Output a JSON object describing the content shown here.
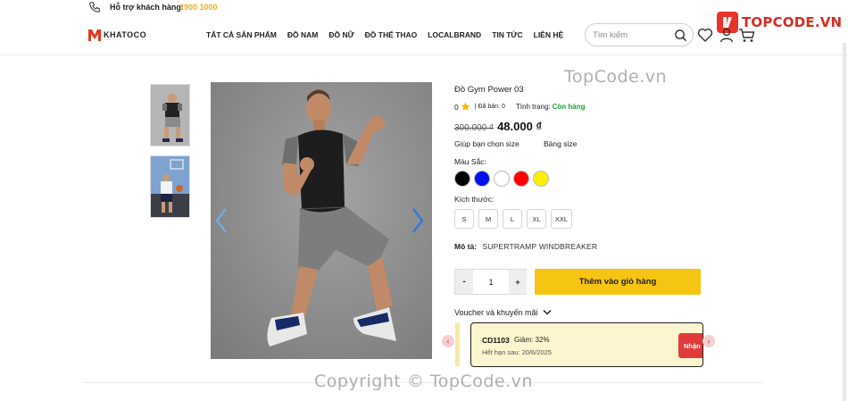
{
  "topbar": {
    "support_label": "Hỗ trợ khách hàng:",
    "support_phone": "1900 1000",
    "phone_icon": "phone-icon"
  },
  "watermark_logo": {
    "text": "TOPCODE.VN"
  },
  "header": {
    "brand_name": "KHATOCO",
    "nav": [
      "TẤT CẢ SẢN PHẨM",
      "ĐỒ NAM",
      "ĐỒ NỮ",
      "ĐỒ THỂ THAO",
      "LOCALBRAND",
      "TIN TỨC",
      "LIÊN HỆ"
    ],
    "search_placeholder": "Tìm kiếm",
    "icons": [
      "search-icon",
      "heart-icon",
      "user-icon",
      "cart-icon"
    ]
  },
  "product": {
    "title": "Đồ Gym Power 03",
    "rating": "0",
    "sold_label": "| Đã bán:",
    "sold_count": "0",
    "status_label": "Tình trạng:",
    "status_value": "Còn hàng",
    "old_price": "300.000 ₫",
    "new_price": "48.000 ₫",
    "size_help": "Giúp bạn chọn size",
    "size_chart": "Bảng size",
    "color_label": "Màu Sắc:",
    "colors": [
      "#000000",
      "#0011ee",
      "#ffffff",
      "#ff0000",
      "#ffee00"
    ],
    "size_label": "Kích thước:",
    "sizes": [
      "S",
      "M",
      "L",
      "XL",
      "XXL"
    ],
    "desc_label": "Mô tả:",
    "desc_value": "SUPERTRAMP WINDBREAKER",
    "quantity": "1",
    "minus": "-",
    "plus": "+",
    "add_to_cart": "Thêm vào giỏ hàng",
    "voucher_title": "Voucher và khuyến mãi"
  },
  "voucher": {
    "code": "CD1103",
    "discount": "Giảm: 32%",
    "expiry": "Hết hạn sau: 20/6/2025",
    "claim": "Nhận"
  },
  "watermarks": {
    "mid": "TopCode.vn",
    "bottom": "Copyright © TopCode.vn"
  }
}
